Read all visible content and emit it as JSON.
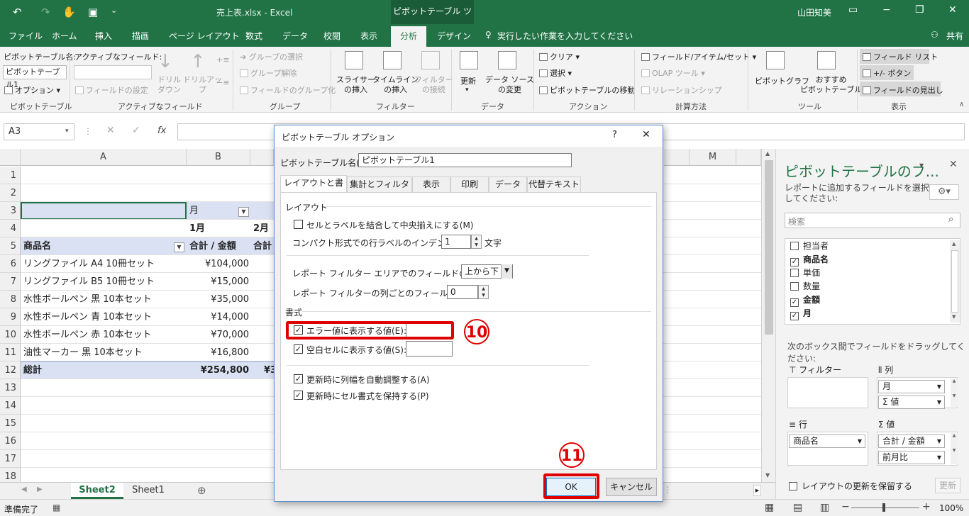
{
  "titlebar": {
    "title": "売上表.xlsx  -  Excel",
    "context_tool": "ピボットテーブル ツール",
    "user": "山田知美"
  },
  "menu": {
    "tabs": [
      "ファイル",
      "ホーム",
      "挿入",
      "描画",
      "ページ レイアウト",
      "数式",
      "データ",
      "校閲",
      "表示",
      "分析",
      "デザイン"
    ],
    "tell_me": "実行したい作業を入力してください",
    "share": "共有"
  },
  "ribbon": {
    "pt_name_label": "ピボットテーブル名:",
    "pt_name_value": "ピボットテーブル1",
    "options": "オプション",
    "group_pivottable": "ピボットテーブル",
    "active_field_label": "アクティブなフィールド:",
    "field_settings": "フィールドの設定",
    "drill_down": "ドリル\nダウン",
    "drill_up": "ドリルアッ\nプ",
    "group_active_field": "アクティブなフィールド",
    "group_selection": "グループの選択",
    "ungroup": "グループ解除",
    "group_field": "フィールドのグループ化",
    "group_group": "グループ",
    "slicer": "スライサー\nの挿入",
    "timeline": "タイムライン\nの挿入",
    "filter_conn": "フィルター\nの接続",
    "group_filter": "フィルター",
    "refresh": "更新",
    "change_source": "データ ソース\nの変更",
    "group_data": "データ",
    "clear": "クリア",
    "select": "選択",
    "move_pt": "ピボットテーブルの移動",
    "group_action": "アクション",
    "fields_items": "フィールド/アイテム/セット",
    "olap": "OLAP ツール",
    "relationships": "リレーションシップ",
    "group_calc": "計算方法",
    "pivot_chart": "ピボットグラフ",
    "recommended": "おすすめ\nピボットテーブル",
    "group_tools": "ツール",
    "field_list": "フィールド リスト",
    "buttons": "+/- ボタン",
    "field_headers": "フィールドの見出し",
    "group_show": "表示"
  },
  "formula": {
    "namebox": "A3",
    "fx": "fx"
  },
  "sheet": {
    "columns": [
      "A",
      "B",
      "M"
    ],
    "rows": [
      "1",
      "2",
      "3",
      "4",
      "5",
      "6",
      "7",
      "8",
      "9",
      "10",
      "11",
      "12",
      "13",
      "14",
      "15",
      "16",
      "17",
      "18"
    ],
    "r3_b": "月",
    "r4_b": "1月",
    "r4_c": "2月",
    "r5_a": "商品名",
    "r5_b": "合計 / 金額",
    "r5_c": "合計",
    "items": [
      {
        "name": "リングファイル A4 10冊セット",
        "val": "¥104,000"
      },
      {
        "name": "リングファイル B5 10冊セット",
        "val": "¥15,000"
      },
      {
        "name": "水性ボールペン 黒 10本セット",
        "val": "¥35,000"
      },
      {
        "name": "水性ボールペン 青 10本セット",
        "val": "¥14,000"
      },
      {
        "name": "水性ボールペン 赤 10本セット",
        "val": "¥70,000"
      },
      {
        "name": "油性マーカー 黒 10本セット",
        "val": "¥16,800"
      }
    ],
    "total_label": "総計",
    "total_val": "¥254,800",
    "total_c": "¥3"
  },
  "tabs": {
    "sheet2": "Sheet2",
    "sheet1": "Sheet1"
  },
  "status": {
    "ready": "準備完了",
    "zoom": "100%"
  },
  "pane": {
    "title": "ピボットテーブルのフ...",
    "subtitle": "レポートに追加するフィールドを選択してください:",
    "search": "検索",
    "fields": [
      {
        "name": "担当者",
        "checked": false
      },
      {
        "name": "商品名",
        "checked": true
      },
      {
        "name": "単価",
        "checked": false
      },
      {
        "name": "数量",
        "checked": false
      },
      {
        "name": "金額",
        "checked": true
      },
      {
        "name": "月",
        "checked": true
      }
    ],
    "drag_hint": "次のボックス間でフィールドをドラッグしてください:",
    "filters": "フィルター",
    "columns": "列",
    "col_item1": "月",
    "col_item2": "Σ 値",
    "rows": "行",
    "row_item": "商品名",
    "values": "値",
    "val_item1": "合計 / 金額",
    "val_item2": "前月比",
    "defer": "レイアウトの更新を保留する",
    "update": "更新"
  },
  "dialog": {
    "title": "ピボットテーブル オプション",
    "help": "?",
    "close": "✕",
    "name_label": "ピボットテーブル名(N):",
    "name_value": "ピボットテーブル1",
    "tabs": [
      "レイアウトと書式",
      "集計とフィルター",
      "表示",
      "印刷",
      "データ",
      "代替テキスト"
    ],
    "layout_heading": "レイアウト",
    "merge_label": "セルとラベルを結合して中央揃えにする(M)",
    "indent_label": "コンパクト形式での行ラベルのインデント(C):",
    "indent_value": "1",
    "indent_unit": "文字",
    "filter_area_label": "レポート フィルター エリアでのフィールドの表示(D):",
    "filter_area_value": "上から下",
    "filter_cols_label": "レポート フィルターの列ごとのフィールド数(F):",
    "filter_cols_value": "0",
    "format_heading": "書式",
    "error_label": "エラー値に表示する値(E):",
    "empty_label": "空白セルに表示する値(S):",
    "autofit_label": "更新時に列幅を自動調整する(A)",
    "preserve_label": "更新時にセル書式を保持する(P)",
    "ok": "OK",
    "cancel": "キャンセル"
  },
  "annotations": {
    "step10": "10",
    "step11": "11"
  },
  "colors": {
    "excel_green": "#217346",
    "pivot_blue": "#d9e1f2",
    "highlight_red": "#e00000"
  }
}
